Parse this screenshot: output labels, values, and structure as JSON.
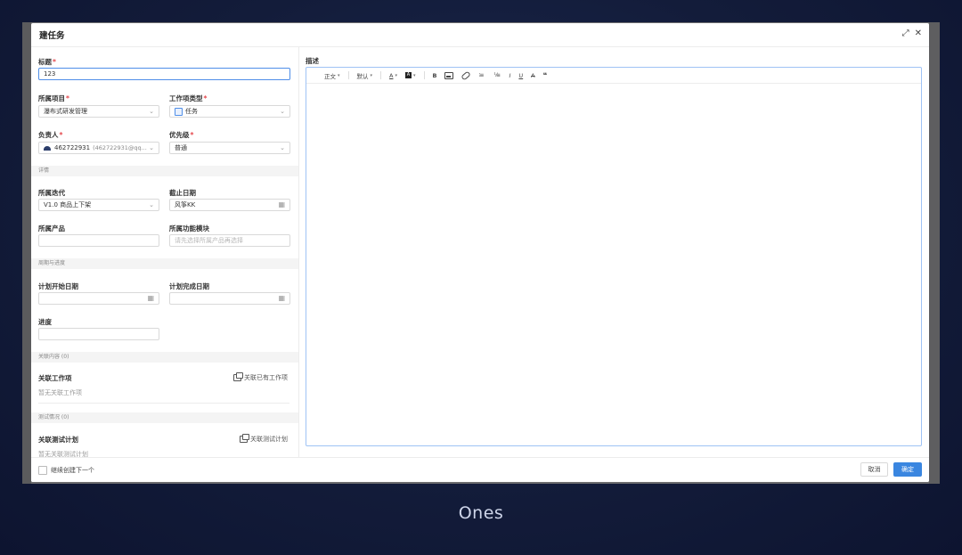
{
  "dialog": {
    "title": "建任务",
    "expand_icon": "expand-icon",
    "close_icon": "close-icon"
  },
  "form": {
    "title_label": "标题",
    "title_value": "123",
    "project_label": "所属项目",
    "project_value": "瀑布式研发管理",
    "type_label": "工作项类型",
    "type_value": "任务",
    "assignee_label": "负责人",
    "assignee_value": "462722931",
    "assignee_email": "(462722931@qq...",
    "priority_label": "优先级",
    "priority_value": "普通",
    "details_section": "详情",
    "iteration_label": "所属迭代",
    "iteration_value": "V1.0 商品上下架",
    "deadline_label": "截止日期",
    "deadline_value": "风筝KK",
    "product_label": "所属产品",
    "module_label": "所属功能模块",
    "module_placeholder": "请先选择所属产品再选择",
    "schedule_section": "周期与进度",
    "plan_start_label": "计划开始日期",
    "plan_end_label": "计划完成日期",
    "progress_label": "进度",
    "related_section": "关联内容 (0)",
    "related_items_label": "关联工作项",
    "related_items_action": "关联已有工作项",
    "related_items_empty": "暂无关联工作项",
    "test_section": "测试情况 (0)",
    "test_plan_label": "关联测试计划",
    "test_plan_action": "关联测试计划",
    "test_plan_empty": "暂无关联测试计划"
  },
  "editor": {
    "label": "描述",
    "toolbar": {
      "paragraph": "正文",
      "font_size": "默认"
    }
  },
  "footer": {
    "continue_label": "继续创建下一个",
    "cancel": "取消",
    "confirm": "确定"
  },
  "caption": "Ones",
  "colors": {
    "primary": "#3a86e0",
    "required": "#e5484d",
    "background": "#131c3a"
  }
}
